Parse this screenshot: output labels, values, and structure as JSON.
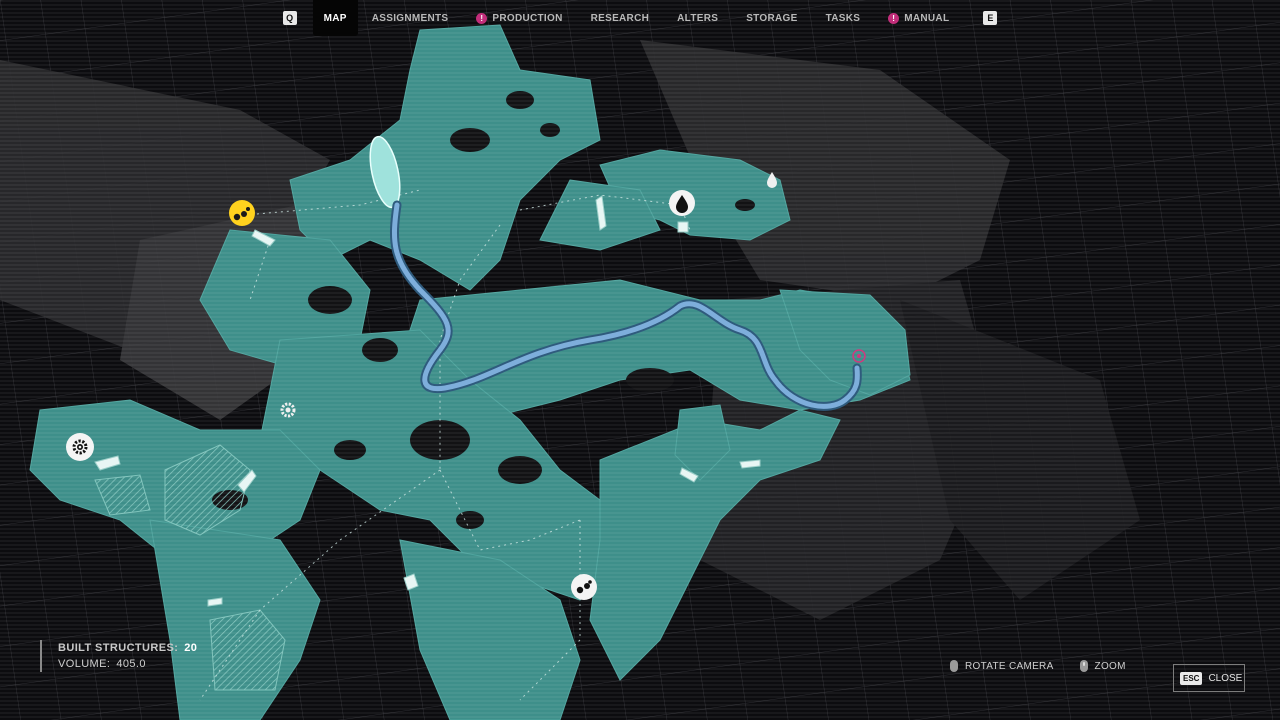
{
  "tabs": {
    "prev_key": "Q",
    "next_key": "E",
    "items": [
      {
        "label": "MAP",
        "active": true,
        "badge": false
      },
      {
        "label": "ASSIGNMENTS",
        "active": false,
        "badge": false
      },
      {
        "label": "PRODUCTION",
        "active": false,
        "badge": true
      },
      {
        "label": "RESEARCH",
        "active": false,
        "badge": false
      },
      {
        "label": "ALTERS",
        "active": false,
        "badge": false
      },
      {
        "label": "STORAGE",
        "active": false,
        "badge": false
      },
      {
        "label": "TASKS",
        "active": false,
        "badge": false
      },
      {
        "label": "MANUAL",
        "active": false,
        "badge": true
      }
    ],
    "badge_glyph": "!"
  },
  "stats": {
    "built_label": "BUILT STRUCTURES:",
    "built_value": "20",
    "volume_label": "VOLUME:",
    "volume_value": "405.0"
  },
  "controls": {
    "rotate_label": "ROTATE CAMERA",
    "zoom_label": "ZOOM",
    "esc_key": "ESC",
    "close_label": "CLOSE"
  },
  "map": {
    "markers": [
      {
        "name": "yellow-resource-marker",
        "icon": "ore-icon"
      },
      {
        "name": "water-resource-marker",
        "icon": "water-drop-icon"
      },
      {
        "name": "gear-marker-left",
        "icon": "gear-icon"
      },
      {
        "name": "ore-marker-bottom",
        "icon": "ore-icon"
      },
      {
        "name": "gear-marker-small",
        "icon": "gear-icon"
      },
      {
        "name": "water-marker-small",
        "icon": "water-drop-icon"
      }
    ]
  },
  "colors": {
    "terrain": "#3e8f8a",
    "route": "#6d9fcf",
    "highlight": "#ffd21e",
    "badge": "#c22d7a"
  }
}
